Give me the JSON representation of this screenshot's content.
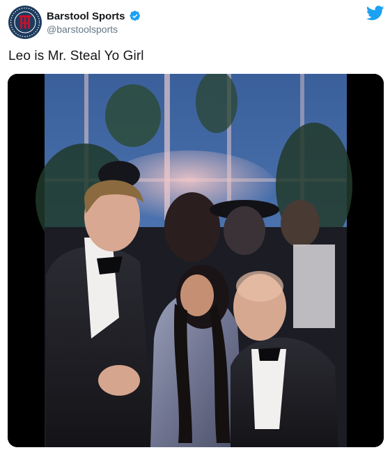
{
  "author": {
    "display_name": "Barstool Sports",
    "handle": "@barstoolsports",
    "avatar_icon": "barstool-logo-icon",
    "verified_icon": "verified-badge-icon"
  },
  "brand": {
    "icon": "twitter-bird-icon",
    "color": "#1da1f2"
  },
  "tweet": {
    "text": "Leo is Mr. Steal Yo Girl"
  },
  "media": {
    "type": "video-still"
  },
  "colors": {
    "text_primary": "#14171a",
    "text_secondary": "#657786",
    "verified": "#1da1f2"
  }
}
